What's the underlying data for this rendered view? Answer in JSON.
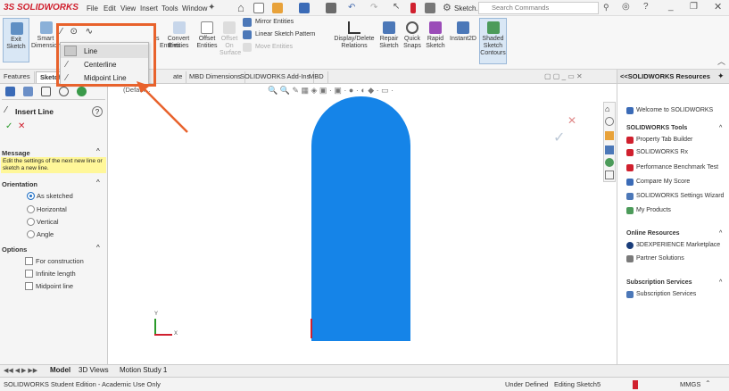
{
  "titlebar": {
    "brand": "SOLIDWORKS",
    "menus": [
      "File",
      "Edit",
      "View",
      "Insert",
      "Tools",
      "Window"
    ],
    "sketch_label": "Sketch...",
    "search_placeholder": "Search Commands"
  },
  "ribbon": {
    "exit_sketch": "Exit Sketch",
    "smart_dimension": "Smart Dimension",
    "convert_entities": "Convert Entities",
    "offset_entities": "Offset Entities",
    "offset_on_surface": "Offset On Surface",
    "mirror_entities": "Mirror Entities",
    "linear_sketch_pattern": "Linear Sketch Pattern",
    "move_entities": "Move Entities",
    "display_delete_relations": "Display/Delete Relations",
    "repair_sketch": "Repair Sketch",
    "quick_snaps": "Quick Snaps",
    "rapid_sketch": "Rapid Sketch",
    "instant2d": "Instant2D",
    "shaded_sketch_contours": "Shaded Sketch Contours",
    "partial_es": "s",
    "partial_entities": "Entities"
  },
  "dropdown": {
    "items": [
      "Line",
      "Centerline",
      "Midpoint Line"
    ]
  },
  "tabs": {
    "items": [
      "Features",
      "Sketch",
      "ate",
      "MBD Dimensions",
      "SOLIDWORKS Add-Ins",
      "MBD"
    ],
    "tree_label": "(Defaul..."
  },
  "leftpanel": {
    "title": "Insert Line",
    "message_header": "Message",
    "message_text": "Edit the settings of the next new line or sketch a new line.",
    "orientation_header": "Orientation",
    "orientation_options": [
      "As sketched",
      "Horizontal",
      "Vertical",
      "Angle"
    ],
    "options_header": "Options",
    "options": [
      "For construction",
      "Infinite length",
      "Midpoint line"
    ]
  },
  "rightpanel": {
    "header": "<<SOLIDWORKS Resources",
    "welcome": "Welcome to SOLIDWORKS",
    "tools_header": "SOLIDWORKS Tools",
    "tools": [
      "Property Tab Builder",
      "SOLIDWORKS Rx",
      "Performance Benchmark Test",
      "Compare My Score",
      "SOLIDWORKS Settings Wizard",
      "My Products"
    ],
    "online_header": "Online Resources",
    "online": [
      "3DEXPERIENCE Marketplace",
      "Partner Solutions"
    ],
    "subscription_header": "Subscription Services",
    "subscription": [
      "Subscription Services"
    ]
  },
  "bottomtabs": {
    "items": [
      "Model",
      "3D Views",
      "Motion Study 1"
    ]
  },
  "statusbar": {
    "left": "SOLIDWORKS Student Edition - Academic Use Only",
    "under_defined": "Under Defined",
    "editing": "Editing Sketch5",
    "units": "MMGS"
  },
  "viewport": {
    "axis_y": "Y",
    "axis_x": "X"
  },
  "colors": {
    "accent": "#1584e8",
    "highlight": "#e8622c",
    "brand": "#d0202e"
  }
}
